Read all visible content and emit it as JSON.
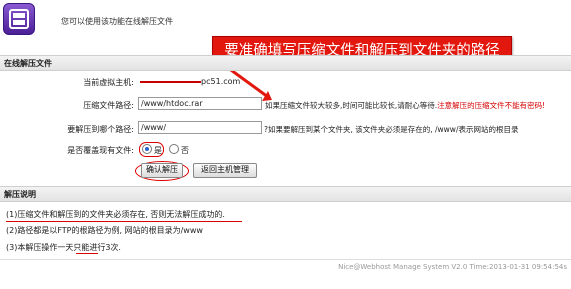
{
  "header": {
    "message": "您可以使用该功能在线解压文件",
    "callout": "要准确填写压缩文件和解压到文件夹的路径"
  },
  "form_section": {
    "title": "在线解压文件",
    "host_label": "当前虚拟主机:",
    "host_value": "pc51.com",
    "archive_label": "压缩文件路径:",
    "archive_value": "/www/htdoc.rar",
    "archive_hint_plain": "如果压缩文件较大较多,时间可能比较长,请耐心等待.",
    "archive_hint_red": "注意解压的压缩文件不能有密码!",
    "target_label": "要解压到哪个路径:",
    "target_value": "/www/",
    "target_hint": "?如果要解压到某个文件夹, 该文件夹必须是存在的, /www/表示网站的根目录",
    "overwrite_label": "是否覆盖现有文件:",
    "overwrite_yes": "是",
    "overwrite_no": "否",
    "overwrite_selected": "是",
    "confirm_button": "确认解压",
    "back_button": "返回主机管理"
  },
  "notes_section": {
    "title": "解压说明",
    "items": [
      "(1)压缩文件和解压到的文件夹必须存在, 否则无法解压成功的.",
      "(2)路径都是以FTP的根路径为例, 网站的根目录为/www",
      "(3)本解压操作一天只能进行3次."
    ]
  },
  "footer": {
    "text": "Nice@Webhost Manage System V2.0 Time:2013-01-31 09:54:54s"
  },
  "colors": {
    "accent_red": "#e2180e",
    "logo_purple": "#6a35c0"
  }
}
